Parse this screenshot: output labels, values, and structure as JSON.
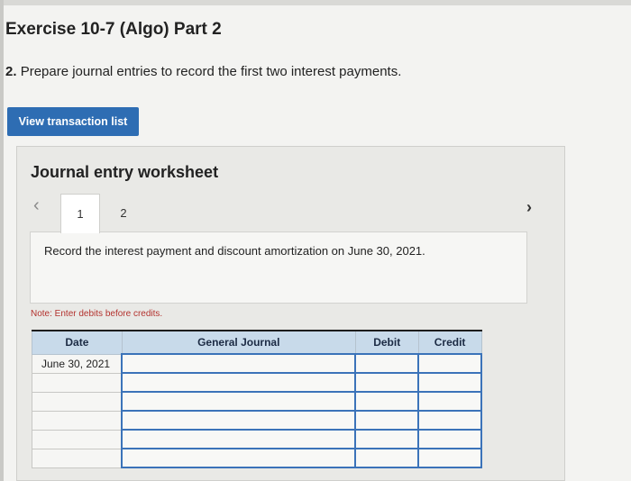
{
  "page": {
    "title": "Exercise 10-7 (Algo) Part 2",
    "instruction_number": "2.",
    "instruction_text": "Prepare journal entries to record the first two interest payments.",
    "view_button": "View transaction list"
  },
  "worksheet": {
    "title": "Journal entry worksheet",
    "prev_icon": "chevron-left-icon",
    "next_icon": "chevron-right-icon",
    "tabs": [
      {
        "label": "1",
        "active": true
      },
      {
        "label": "2",
        "active": false
      }
    ],
    "description": "Record the interest payment and discount amortization on June 30, 2021.",
    "note": "Note: Enter debits before credits."
  },
  "table": {
    "headers": {
      "date": "Date",
      "general_journal": "General Journal",
      "debit": "Debit",
      "credit": "Credit"
    },
    "rows": [
      {
        "date": "June 30, 2021",
        "account": "",
        "debit": "",
        "credit": ""
      },
      {
        "date": "",
        "account": "",
        "debit": "",
        "credit": ""
      },
      {
        "date": "",
        "account": "",
        "debit": "",
        "credit": ""
      },
      {
        "date": "",
        "account": "",
        "debit": "",
        "credit": ""
      },
      {
        "date": "",
        "account": "",
        "debit": "",
        "credit": ""
      },
      {
        "date": "",
        "account": "",
        "debit": "",
        "credit": ""
      }
    ]
  },
  "colors": {
    "button": "#2e6db3",
    "header_bg": "#c8daea",
    "note": "#b3322e",
    "input_border": "#3b73b9"
  }
}
